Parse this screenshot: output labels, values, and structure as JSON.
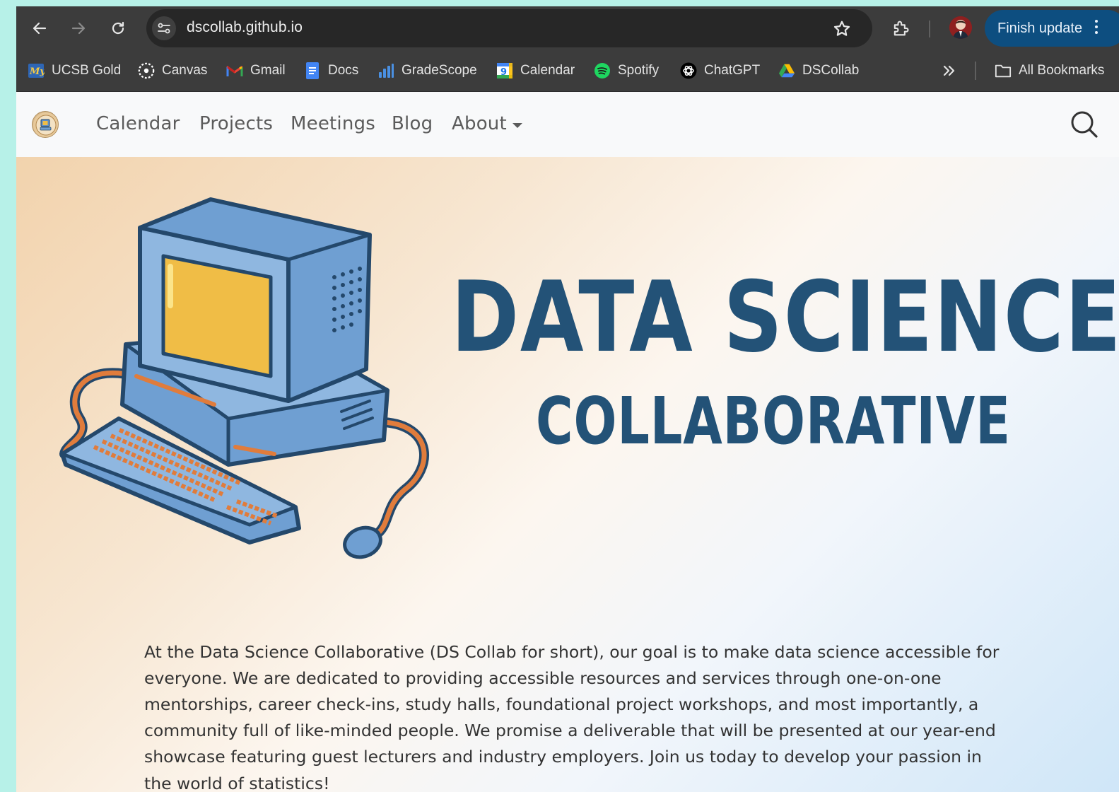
{
  "browser": {
    "url": "dscollab.github.io",
    "finish_update_label": "Finish update"
  },
  "bookmarks": [
    {
      "label": "UCSB Gold",
      "icon": "mygold-icon"
    },
    {
      "label": "Canvas",
      "icon": "canvas-icon"
    },
    {
      "label": "Gmail",
      "icon": "gmail-icon"
    },
    {
      "label": "Docs",
      "icon": "docs-icon"
    },
    {
      "label": "GradeScope",
      "icon": "gradescope-icon"
    },
    {
      "label": "Calendar",
      "icon": "google-calendar-icon"
    },
    {
      "label": "Spotify",
      "icon": "spotify-icon"
    },
    {
      "label": "ChatGPT",
      "icon": "chatgpt-icon"
    },
    {
      "label": "DSCollab",
      "icon": "google-drive-icon"
    }
  ],
  "all_bookmarks_label": "All Bookmarks",
  "nav": {
    "items": [
      "Calendar",
      "Projects",
      "Meetings",
      "Blog",
      "About"
    ]
  },
  "hero": {
    "title": "DATA SCIENCE",
    "subtitle": "COLLABORATIVE",
    "description": "At the Data Science Collaborative (DS Collab for short), our goal is to make data science accessible for everyone. We are dedicated to providing accessible resources and services through one-on-one mentorships, career check-ins, study halls, foundational project workshops, and most importantly, a community full of like-minded people. We promise a deliverable that will be presented at our year-end showcase featuring guest lecturers and industry employers. Join us today to develop your passion in the world of statistics!"
  },
  "colors": {
    "brand_navy": "#235277",
    "update_button": "#0d4e80",
    "page_bg": "#b7f1e8"
  }
}
